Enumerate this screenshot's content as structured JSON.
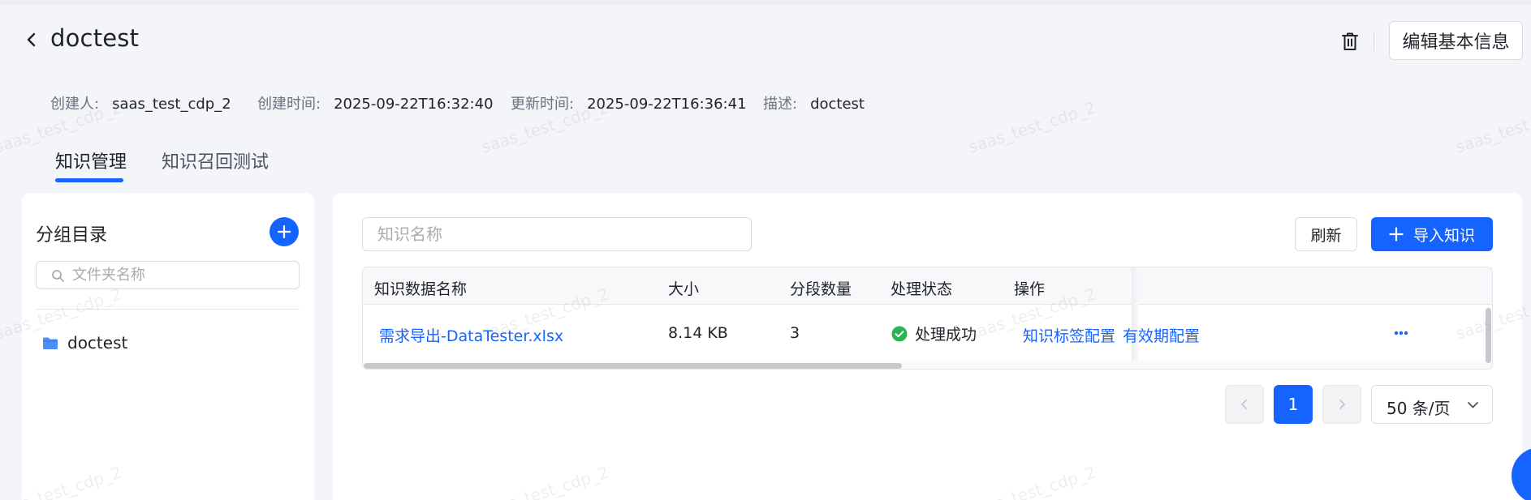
{
  "header": {
    "title": "doctest",
    "edit_label": "编辑基本信息"
  },
  "meta": {
    "creator_label": "创建人:",
    "creator": "saas_test_cdp_2",
    "created_label": "创建时间:",
    "created": "2025-09-22T16:32:40",
    "updated_label": "更新时间:",
    "updated": "2025-09-22T16:36:41",
    "desc_label": "描述:",
    "desc": "doctest"
  },
  "tabs": [
    {
      "label": "知识管理",
      "active": true
    },
    {
      "label": "知识召回测试",
      "active": false
    }
  ],
  "sidebar": {
    "title": "分组目录",
    "search_placeholder": "文件夹名称",
    "folders": [
      {
        "label": "doctest"
      }
    ]
  },
  "main": {
    "search_placeholder": "知识名称",
    "refresh_label": "刷新",
    "import_label": "导入知识",
    "table": {
      "columns": [
        "知识数据名称",
        "大小",
        "分段数量",
        "处理状态",
        "操作"
      ],
      "rows": [
        {
          "name": "需求导出-DataTester.xlsx",
          "size": "8.14 KB",
          "segments": "3",
          "status": "处理成功",
          "actions": [
            "知识标签配置",
            "有效期配置"
          ]
        }
      ]
    },
    "pagination": {
      "current_page": "1",
      "page_size": "50 条/页"
    }
  },
  "watermark": "saas_test_cdp_2",
  "colors": {
    "accent": "#1664ff",
    "success": "#2bb454",
    "background": "#f3f5f8"
  }
}
